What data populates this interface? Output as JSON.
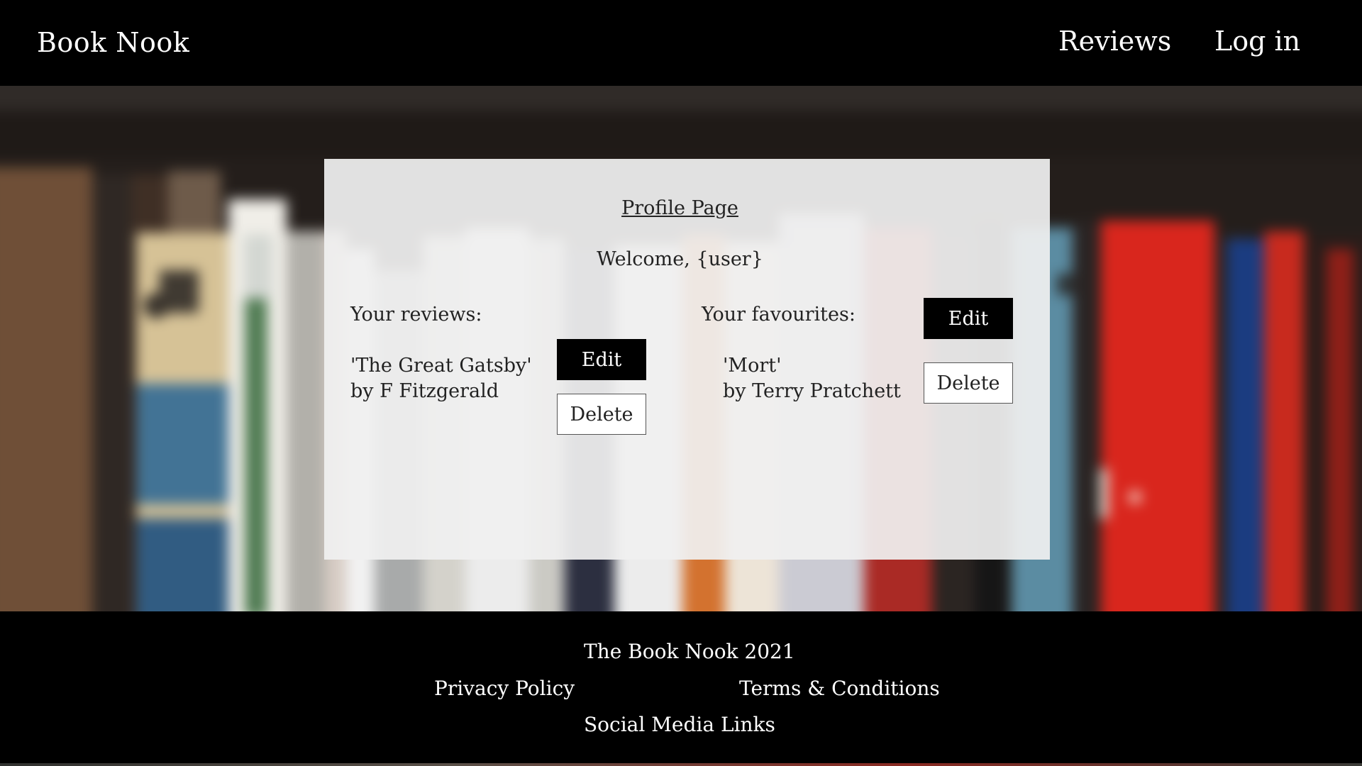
{
  "header": {
    "brand": "Book Nook",
    "nav": {
      "reviews": "Reviews",
      "login": "Log in"
    }
  },
  "profile": {
    "title": "Profile Page",
    "welcome": "Welcome, {user}",
    "reviews": {
      "heading": "Your reviews:",
      "items": [
        {
          "title": "'The Great Gatsby'",
          "author": "by F Fitzgerald",
          "edit_label": "Edit",
          "delete_label": "Delete"
        }
      ]
    },
    "favourites": {
      "heading": "Your favourites:",
      "edit_label": "Edit",
      "items": [
        {
          "title": "'Mort'",
          "author": "by Terry Pratchett",
          "delete_label": "Delete"
        }
      ]
    }
  },
  "footer": {
    "copyright": "The Book Nook 2021",
    "privacy": "Privacy Policy",
    "terms": "Terms & Conditions",
    "social": "Social Media Links"
  },
  "colors": {
    "header_bg": "#000000",
    "card_bg": "#f0f0f0",
    "primary_button": "#000000",
    "secondary_button": "#ffffff"
  },
  "icons": {
    "background": "bookshelf-image"
  }
}
